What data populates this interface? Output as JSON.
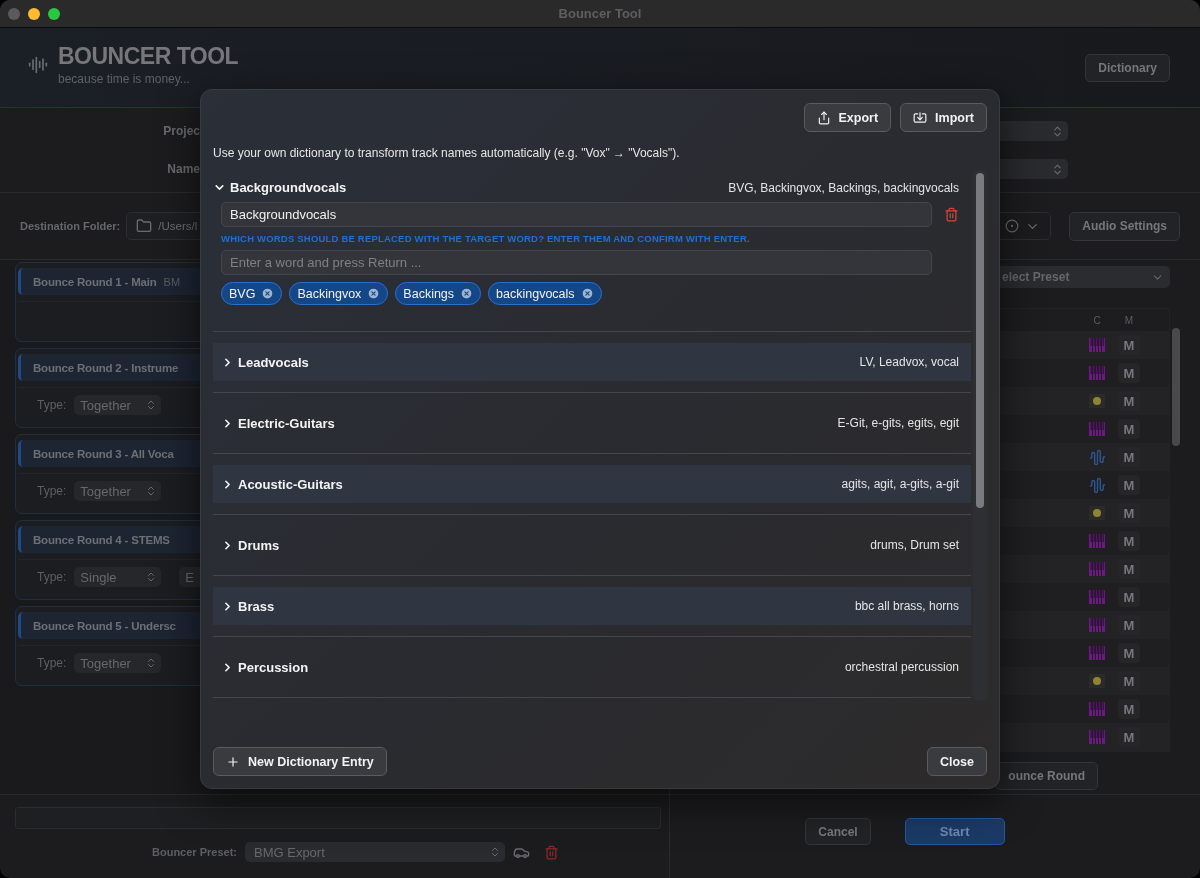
{
  "window": {
    "title": "Bouncer Tool"
  },
  "header": {
    "title": "BOUNCER TOOL",
    "subtitle": "because time is money...",
    "dictionary_button": "Dictionary"
  },
  "project_form": {
    "fields": [
      {
        "label": "Projec"
      },
      {
        "label": "Name"
      }
    ]
  },
  "destination": {
    "label": "Destination Folder:",
    "path": "/Users/l",
    "audio_settings_button": "Audio Settings"
  },
  "bounce_rounds": [
    {
      "title": "Bounce Round 1 - Main",
      "tag": "BM"
    },
    {
      "title": "Bounce Round 2 - Instrume",
      "type_label": "Type:",
      "type": "Together"
    },
    {
      "title": "Bounce Round 3 - All Voca",
      "type_label": "Type:",
      "type": "Together"
    },
    {
      "title": "Bounce Round 4 - STEMS",
      "type_label": "Type:",
      "type": "Single",
      "extra": "E"
    },
    {
      "title": "Bounce Round 5 - Undersc",
      "type_label": "Type:",
      "type": "Together"
    }
  ],
  "track_panel": {
    "preset_select": "elect Preset",
    "columns": [
      "C",
      "M"
    ],
    "rows": [
      {
        "kind": "piano",
        "mute": "M"
      },
      {
        "kind": "piano",
        "mute": "M"
      },
      {
        "kind": "dot",
        "mute": "M"
      },
      {
        "kind": "piano",
        "mute": "M"
      },
      {
        "kind": "wave",
        "mute": "M"
      },
      {
        "kind": "wave",
        "mute": "M"
      },
      {
        "kind": "dot",
        "mute": "M"
      },
      {
        "kind": "piano",
        "mute": "M"
      },
      {
        "kind": "piano",
        "mute": "M"
      },
      {
        "kind": "piano",
        "mute": "M"
      },
      {
        "kind": "piano",
        "mute": "M"
      },
      {
        "kind": "piano",
        "mute": "M"
      },
      {
        "kind": "dot",
        "mute": "M"
      },
      {
        "kind": "piano",
        "mute": "M"
      },
      {
        "kind": "piano",
        "mute": "M"
      }
    ],
    "add_button": "ounce Round"
  },
  "footer": {
    "preset_label": "Bouncer Preset:",
    "preset": "BMG Export",
    "cancel_button": "Cancel",
    "start_button": "Start"
  },
  "dictionary_dialog": {
    "export_button": "Export",
    "import_button": "Import",
    "description": "Use your own dictionary to transform track names automatically (e.g. \"Vox\" → \"Vocals\").",
    "entries": [
      {
        "name": "Backgroundvocals",
        "summary": "BVG, Backingvox, Backings, backingvocals",
        "expanded": true,
        "target": "Backgroundvocals",
        "hint": "WHICH WORDS SHOULD BE REPLACED WITH THE TARGET WORD? ENTER THEM AND CONFIRM WITH ENTER.",
        "placeholder": "Enter a word and press Return ...",
        "words": [
          "BVG",
          "Backingvox",
          "Backings",
          "backingvocals"
        ]
      },
      {
        "name": "Leadvocals",
        "summary": "LV, Leadvox, vocal",
        "expanded": false
      },
      {
        "name": "Electric-Guitars",
        "summary": "E-Git, e-gits, egits, egit",
        "expanded": false
      },
      {
        "name": "Acoustic-Guitars",
        "summary": "agits, agit, a-gits, a-git",
        "expanded": false
      },
      {
        "name": "Drums",
        "summary": "drums, Drum set",
        "expanded": false
      },
      {
        "name": "Brass",
        "summary": "bbc all brass, horns",
        "expanded": false
      },
      {
        "name": "Percussion",
        "summary": "orchestral percussion",
        "expanded": false
      }
    ],
    "new_entry_button": "New Dictionary Entry",
    "close_button": "Close"
  }
}
